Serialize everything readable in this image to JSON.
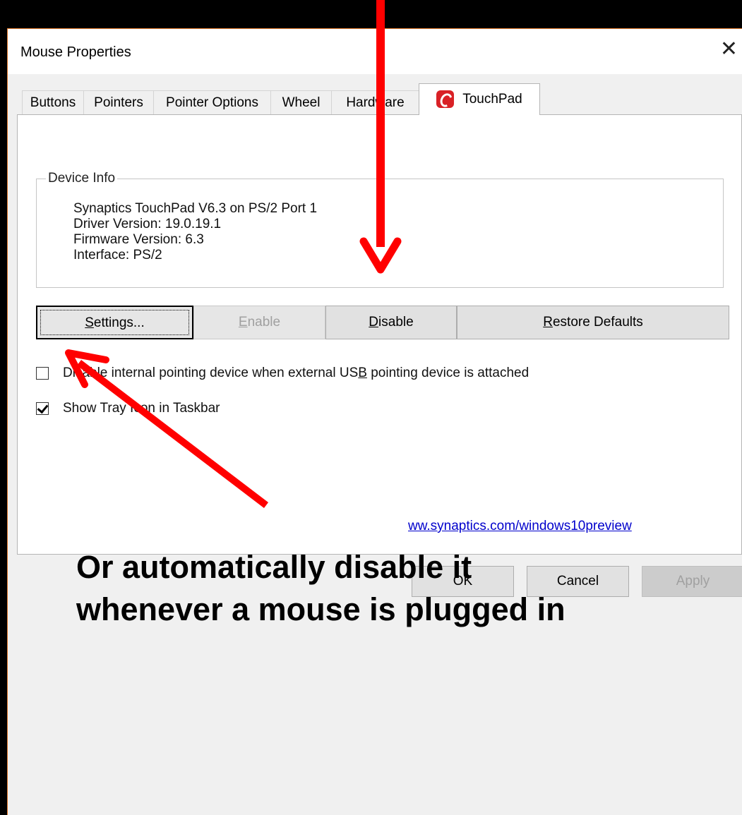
{
  "window": {
    "title": "Mouse Properties",
    "close_glyph": "✕"
  },
  "tabs": [
    {
      "label": "Buttons"
    },
    {
      "label": "Pointers"
    },
    {
      "label": "Pointer Options"
    },
    {
      "label": "Wheel"
    },
    {
      "label": "Hardware"
    },
    {
      "label": "TouchPad",
      "active": true
    }
  ],
  "device_info": {
    "legend": "Device Info",
    "lines": [
      "Synaptics TouchPad V6.3 on PS/2 Port 1",
      "Driver Version: 19.0.19.1",
      "Firmware Version: 6.3",
      "Interface: PS/2"
    ]
  },
  "buttons": {
    "settings": {
      "mn": "S",
      "rest": "ettings..."
    },
    "enable": {
      "mn": "E",
      "rest": "nable"
    },
    "disable": {
      "mn": "D",
      "rest": "isable"
    },
    "restore": {
      "mn": "R",
      "rest": "estore Defaults"
    }
  },
  "checkboxes": {
    "disable_internal": {
      "checked": false,
      "pre": "Disable internal pointing device when external US",
      "mn": "B",
      "post": " pointing device is attached"
    },
    "show_tray": {
      "checked": true,
      "label": "Show Tray Icon in Taskbar"
    }
  },
  "link": "ww.synaptics.com/windows10preview",
  "dialog_buttons": {
    "ok": "OK",
    "cancel": "Cancel",
    "apply": "Apply"
  },
  "annotation": {
    "line1": "Or automatically disable it",
    "line2": "whenever a mouse is plugged in",
    "color": "#ff0000"
  },
  "colors": {
    "accent_border": "#e0782a",
    "touchpad_logo": "#d92126",
    "link": "#0000cc"
  }
}
